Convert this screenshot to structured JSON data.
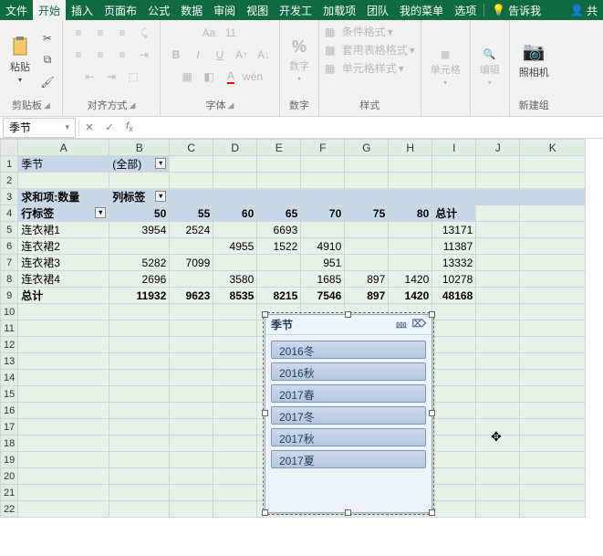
{
  "tabs": {
    "file": "文件",
    "home": "开始",
    "insert": "插入",
    "layout": "页面布",
    "formula": "公式",
    "data": "数据",
    "review": "审阅",
    "view": "视图",
    "dev": "开发工",
    "addin": "加载项",
    "team": "团队",
    "mymenu": "我的菜单",
    "options": "选项",
    "tellme": "告诉我",
    "share": "共"
  },
  "ribbon": {
    "clipboard": {
      "paste": "粘贴",
      "label": "剪贴板"
    },
    "alignment": {
      "label": "对齐方式"
    },
    "font": {
      "label": "字体",
      "ruby": "wén"
    },
    "number": {
      "btn": "数字",
      "label": "数字"
    },
    "styles": {
      "label": "样式",
      "condfmt": "条件格式",
      "tablefmt": "套用表格格式",
      "cellfmt": "单元格样式"
    },
    "cells": {
      "btn": "单元格"
    },
    "editing": {
      "btn": "编辑"
    },
    "newgroup": {
      "btn": "照相机",
      "label": "新建组"
    }
  },
  "fbar": {
    "name": "季节"
  },
  "columns": [
    "A",
    "B",
    "C",
    "D",
    "E",
    "F",
    "G",
    "H",
    "I",
    "J",
    "K"
  ],
  "pivot": {
    "page_field": "季节",
    "page_value": "(全部)",
    "data_label": "求和项:数量",
    "col_label": "列标签",
    "row_label": "行标签",
    "grand_label": "总计",
    "col_headers": [
      "50",
      "55",
      "60",
      "65",
      "70",
      "75",
      "80"
    ],
    "rows": [
      {
        "label": "连衣裙1",
        "vals": [
          "3954",
          "2524",
          "",
          "6693",
          "",
          "",
          "",
          ""
        ],
        "total": "13171"
      },
      {
        "label": "连衣裙2",
        "vals": [
          "",
          "",
          "4955",
          "1522",
          "4910",
          "",
          "",
          ""
        ],
        "total": "11387"
      },
      {
        "label": "连衣裙3",
        "vals": [
          "5282",
          "7099",
          "",
          "",
          "951",
          "",
          "",
          ""
        ],
        "total": "13332"
      },
      {
        "label": "连衣裙4",
        "vals": [
          "2696",
          "",
          "3580",
          "",
          "1685",
          "897",
          "1420"
        ],
        "total": "10278"
      }
    ],
    "grand": {
      "vals": [
        "11932",
        "9623",
        "8535",
        "8215",
        "7546",
        "897",
        "1420"
      ],
      "total": "48168"
    }
  },
  "slicer": {
    "title": "季节",
    "items": [
      "2016冬",
      "2016秋",
      "2017春",
      "2017冬",
      "2017秋",
      "2017夏"
    ]
  }
}
